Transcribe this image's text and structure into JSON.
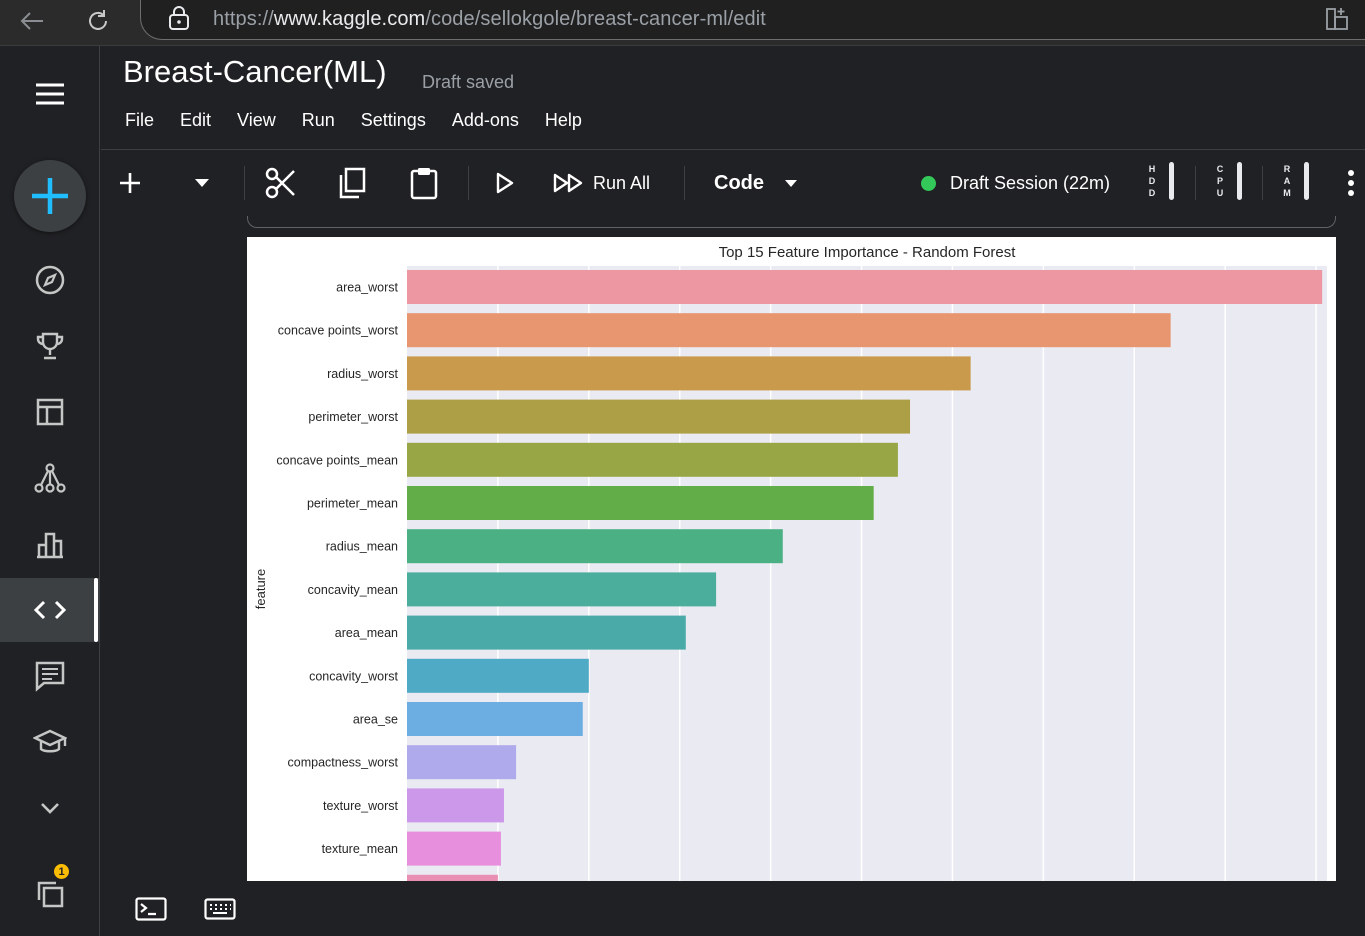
{
  "browser": {
    "url_prefix": "https://",
    "url_host": "www.kaggle.com",
    "url_path": "/code/sellokgole/breast-cancer-ml/edit"
  },
  "notebook": {
    "title": "Breast-Cancer(ML)",
    "save_status": "Draft saved"
  },
  "menu": [
    "File",
    "Edit",
    "View",
    "Run",
    "Settings",
    "Add-ons",
    "Help"
  ],
  "toolbar": {
    "run_all_label": "Run All",
    "cell_type": "Code",
    "session_label": "Draft Session (22m)",
    "session_status_color": "#34c759",
    "meters": [
      {
        "letters": [
          "H",
          "D",
          "D"
        ]
      },
      {
        "letters": [
          "C",
          "P",
          "U"
        ]
      },
      {
        "letters": [
          "R",
          "A",
          "M"
        ]
      }
    ]
  },
  "sidebar": {
    "items": [
      {
        "icon": "compass-icon"
      },
      {
        "icon": "trophy-icon"
      },
      {
        "icon": "table-icon"
      },
      {
        "icon": "models-icon"
      },
      {
        "icon": "bar-chart-icon"
      },
      {
        "icon": "code-icon",
        "active": true
      },
      {
        "icon": "discussion-icon"
      },
      {
        "icon": "learn-icon"
      },
      {
        "icon": "chevron-down-icon"
      }
    ],
    "notification_count": "1"
  },
  "chart_data": {
    "type": "bar",
    "orientation": "horizontal",
    "title": "Top 15 Feature Importance - Random Forest",
    "ylabel": "feature",
    "xlabel": "",
    "xlim": [
      0,
      0.1518
    ],
    "grid": true,
    "categories": [
      "area_worst",
      "concave points_worst",
      "radius_worst",
      "perimeter_worst",
      "concave points_mean",
      "perimeter_mean",
      "radius_mean",
      "concavity_mean",
      "area_mean",
      "concavity_worst",
      "area_se",
      "compactness_worst",
      "texture_worst",
      "texture_mean",
      ""
    ],
    "values": [
      0.151,
      0.126,
      0.093,
      0.083,
      0.081,
      0.077,
      0.062,
      0.051,
      0.046,
      0.03,
      0.029,
      0.018,
      0.016,
      0.0155,
      0.015
    ],
    "colors": [
      "#ec97a2",
      "#e8966f",
      "#c99a4b",
      "#ad9f45",
      "#98a645",
      "#62ad48",
      "#4bb184",
      "#4bae9c",
      "#49aaa7",
      "#4faac6",
      "#6daee2",
      "#aeaaec",
      "#cc98ea",
      "#e78edc",
      "#ea8fb4"
    ]
  }
}
